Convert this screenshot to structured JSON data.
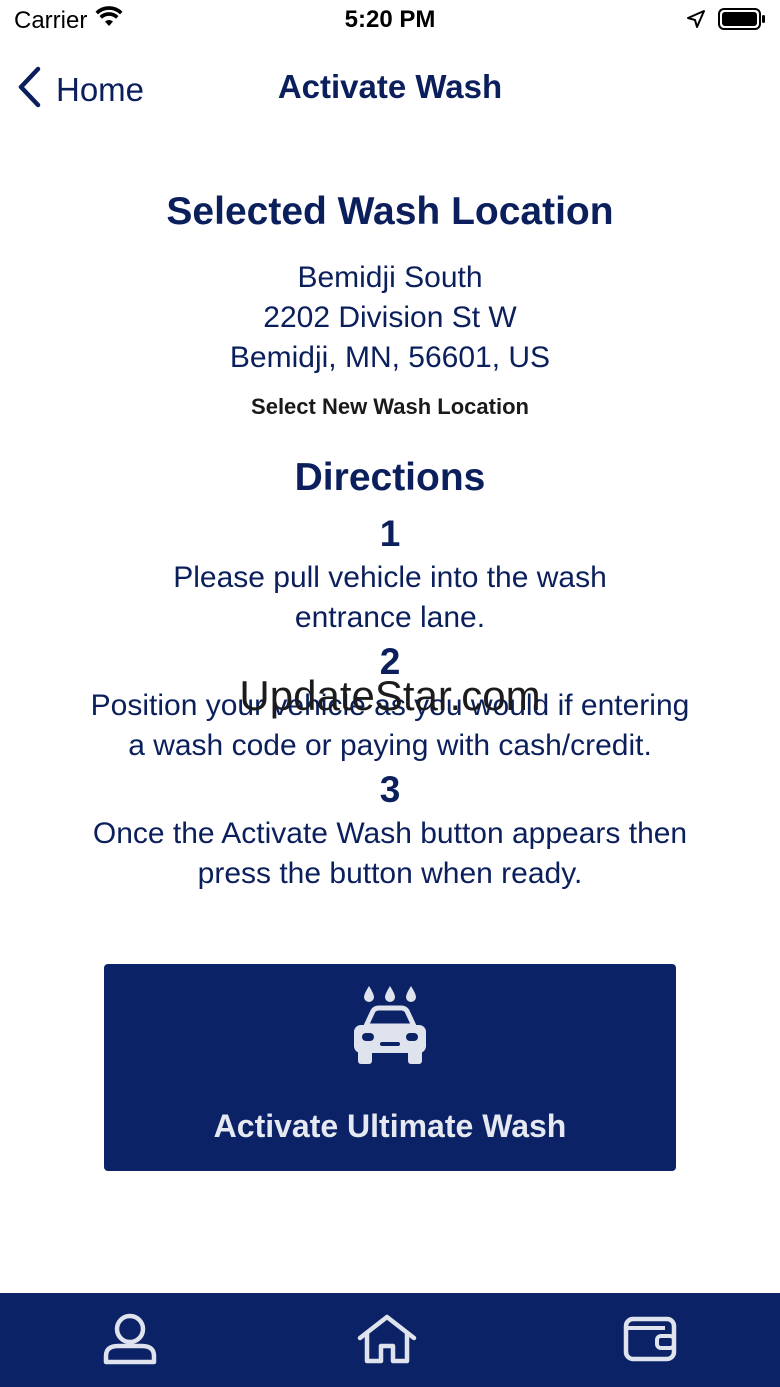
{
  "status_bar": {
    "carrier": "Carrier",
    "time": "5:20 PM"
  },
  "nav": {
    "back_label": "Home",
    "title": "Activate Wash"
  },
  "location": {
    "heading": "Selected Wash Location",
    "name": "Bemidji South",
    "street": "2202 Division St W",
    "city_line": "Bemidji, MN, 56601, US",
    "select_link": "Select New Wash Location"
  },
  "directions": {
    "heading": "Directions",
    "steps": [
      {
        "number": "1",
        "line1": "Please pull vehicle into the wash",
        "line2": "entrance lane."
      },
      {
        "number": "2",
        "line1": "Position your vehicle as you would if entering",
        "line2": "a wash code or paying with cash/credit."
      },
      {
        "number": "3",
        "line1": "Once the Activate Wash button appears then",
        "line2": "press the button when ready."
      }
    ]
  },
  "watermark": "UpdateStar.com",
  "activate_button": {
    "label": "Activate Ultimate Wash",
    "icon": "car-wash-icon"
  },
  "tab_bar": {
    "tabs": [
      {
        "icon": "profile-icon"
      },
      {
        "icon": "home-icon"
      },
      {
        "icon": "wallet-icon"
      }
    ]
  },
  "colors": {
    "brand": "#0c2266",
    "text": "#0b1f5c"
  }
}
